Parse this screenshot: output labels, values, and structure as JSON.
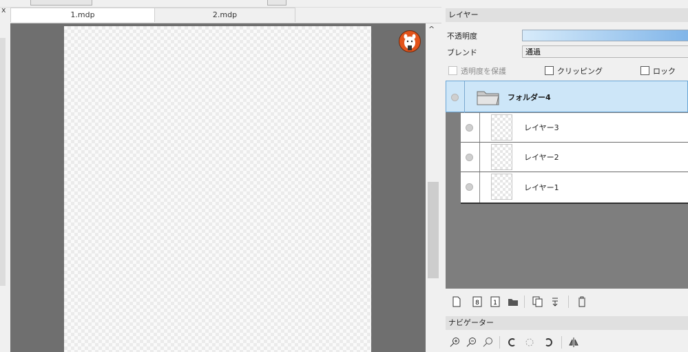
{
  "tabs": [
    {
      "label": "1.mdp",
      "active": true
    },
    {
      "label": "2.mdp",
      "active": false
    }
  ],
  "left_strip": {
    "close_glyph": "x"
  },
  "scrollbar": {
    "up_arrow": "^"
  },
  "layer_panel": {
    "title": "レイヤー",
    "opacity_label": "不透明度",
    "opacity_value_percent": 100,
    "blend_label": "ブレンド",
    "blend_value": "通過",
    "protect_alpha": {
      "label": "透明度を保護",
      "checked": false,
      "enabled": false
    },
    "clipping": {
      "label": "クリッピング",
      "checked": false
    },
    "lock": {
      "label": "ロック",
      "checked": false
    },
    "folder": {
      "label": "フォルダー4",
      "selected": true
    },
    "layers": [
      {
        "label": "レイヤー3"
      },
      {
        "label": "レイヤー2"
      },
      {
        "label": "レイヤー1"
      }
    ],
    "toolbar": [
      "new-layer-icon",
      "new-8bit-layer-icon",
      "new-1bit-layer-icon",
      "new-folder-icon",
      "duplicate-layer-icon",
      "merge-down-icon",
      "delete-layer-icon"
    ]
  },
  "navigator_panel": {
    "title": "ナビゲーター",
    "toolbar": [
      "zoom-in-icon",
      "zoom-out-icon",
      "zoom-fit-icon",
      "rotate-left-icon",
      "rotate-reset-icon",
      "rotate-right-icon",
      "flip-horizontal-icon"
    ]
  },
  "colors": {
    "canvas_bg": "#6f6f6f",
    "selected_row": "#cde6f8",
    "opacity_bar": "#7db3e8",
    "layer_list_bg": "#7e7e7e"
  }
}
